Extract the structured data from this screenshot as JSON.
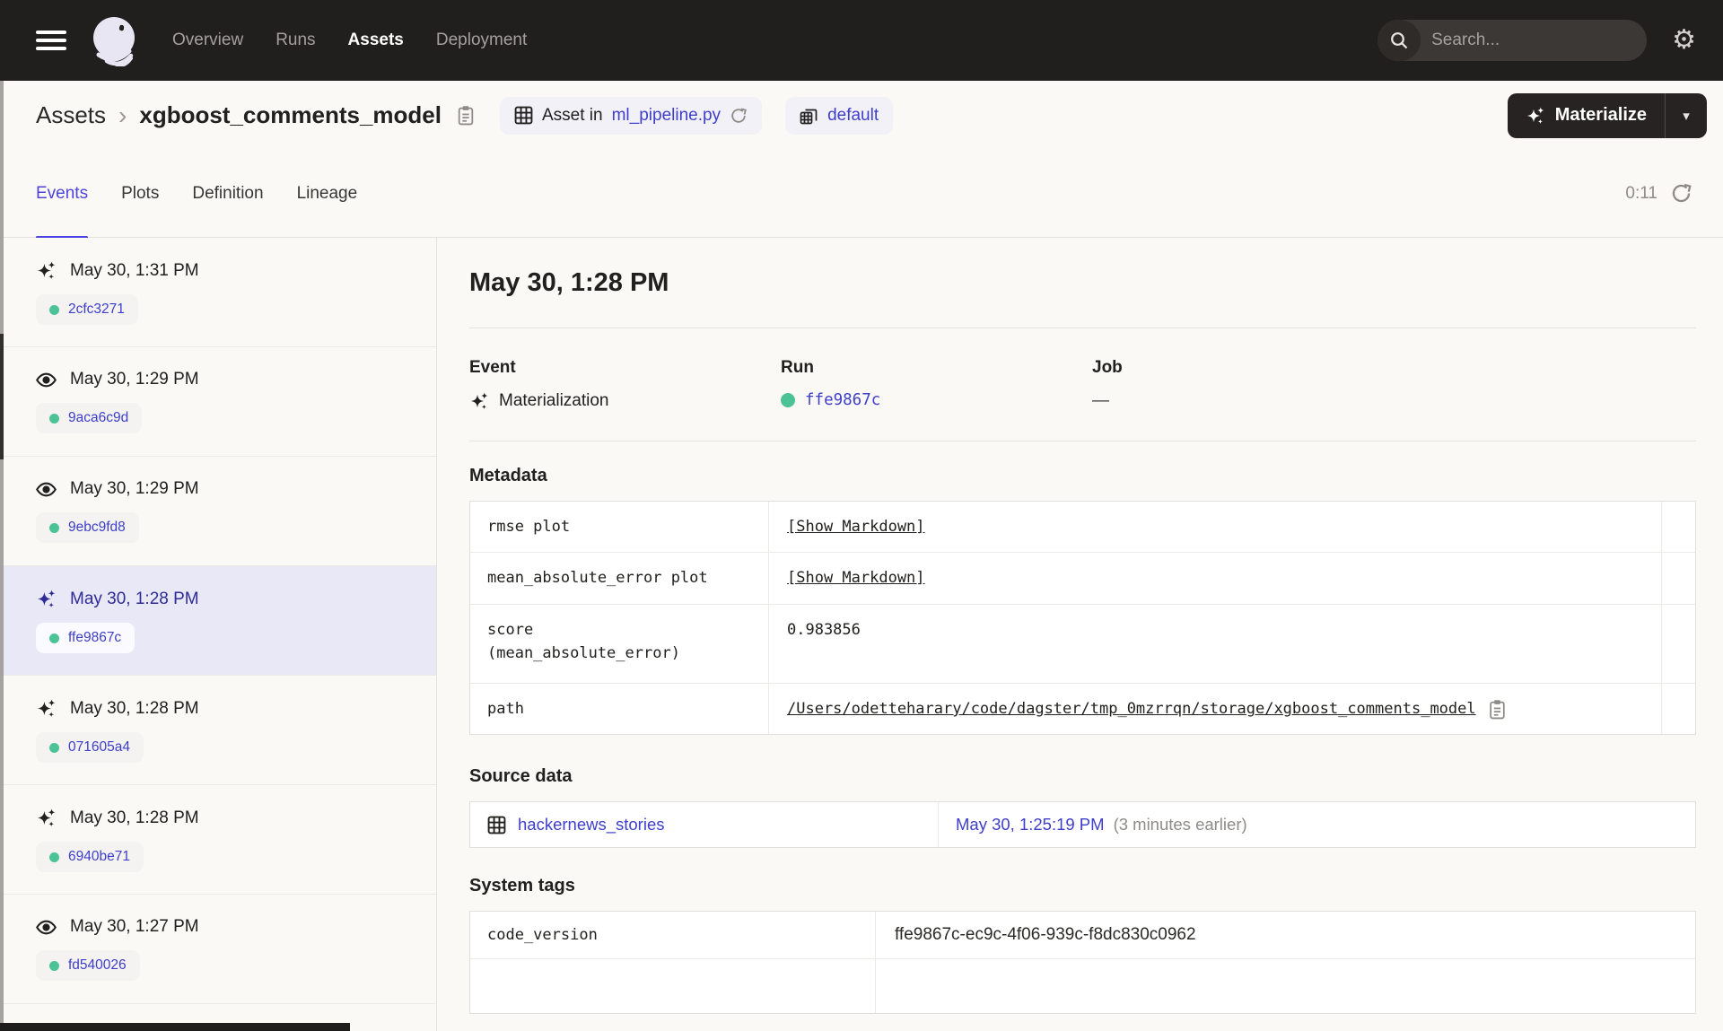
{
  "colors": {
    "topbar_bg": "#211E1E",
    "accent_indigo": "#4F43DD",
    "link_blue": "#3E3ECB",
    "success_green": "#4CC397",
    "selected_row_bg": "#E9E8F7",
    "page_bg": "#FAF9F6"
  },
  "topbar": {
    "nav": [
      {
        "label": "Overview"
      },
      {
        "label": "Runs"
      },
      {
        "label": "Assets"
      },
      {
        "label": "Deployment"
      }
    ],
    "active_nav": "Assets",
    "search": {
      "placeholder": "Search...",
      "shortcut": "/"
    }
  },
  "header": {
    "breadcrumb": {
      "root": "Assets",
      "separator": "›",
      "title": "xgboost_comments_model"
    },
    "asset_location": {
      "prefix": "Asset in ",
      "link": "ml_pipeline.py"
    },
    "group_tag": {
      "label": "default"
    },
    "materialize_button": {
      "label": "Materialize"
    }
  },
  "tabs": {
    "items": [
      {
        "label": "Events"
      },
      {
        "label": "Plots"
      },
      {
        "label": "Definition"
      },
      {
        "label": "Lineage"
      }
    ],
    "active": "Events",
    "timer": "0:11"
  },
  "sidebar": {
    "events": [
      {
        "type": "materialization",
        "timestamp": "May 30, 1:31 PM",
        "run_id": "2cfc3271",
        "selected": false
      },
      {
        "type": "observation",
        "timestamp": "May 30, 1:29 PM",
        "run_id": "9aca6c9d",
        "selected": false
      },
      {
        "type": "observation",
        "timestamp": "May 30, 1:29 PM",
        "run_id": "9ebc9fd8",
        "selected": false
      },
      {
        "type": "materialization",
        "timestamp": "May 30, 1:28 PM",
        "run_id": "ffe9867c",
        "selected": true
      },
      {
        "type": "materialization",
        "timestamp": "May 30, 1:28 PM",
        "run_id": "071605a4",
        "selected": false
      },
      {
        "type": "materialization",
        "timestamp": "May 30, 1:28 PM",
        "run_id": "6940be71",
        "selected": false
      },
      {
        "type": "observation",
        "timestamp": "May 30, 1:27 PM",
        "run_id": "fd540026",
        "selected": false
      }
    ]
  },
  "main": {
    "title": "May 30, 1:28 PM",
    "summary": {
      "event_label": "Event",
      "event_value": "Materialization",
      "run_label": "Run",
      "run_value": "ffe9867c",
      "job_label": "Job",
      "job_value": "—"
    },
    "metadata": {
      "heading": "Metadata",
      "rows": [
        {
          "key": "rmse plot",
          "value": "[Show Markdown]"
        },
        {
          "key": "mean_absolute_error plot",
          "value": "[Show Markdown]"
        },
        {
          "key": "score\n(mean_absolute_error)",
          "value": "0.983856"
        },
        {
          "key": "path",
          "value": "/Users/odetteharary/code/dagster/tmp_0mzrrqn/storage/xgboost_comments_model"
        }
      ]
    },
    "source_data": {
      "heading": "Source data",
      "asset": "hackernews_stories",
      "timestamp": "May 30, 1:25:19 PM",
      "note": "(3 minutes earlier)"
    },
    "system_tags": {
      "heading": "System tags",
      "rows": [
        {
          "key": "code_version",
          "value": "ffe9867c-ec9c-4f06-939c-f8dc830c0962"
        }
      ]
    }
  }
}
